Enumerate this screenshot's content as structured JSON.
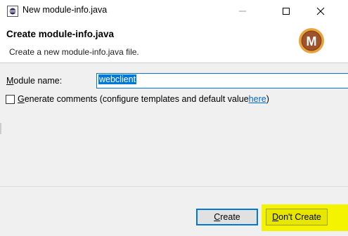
{
  "window": {
    "title": "New module-info.java",
    "controls": {
      "minimize": "—",
      "maximize": "☐",
      "close": "✕"
    },
    "icon": "eclipse-icon"
  },
  "header": {
    "title": "Create module-info.java",
    "description": "Create a new module-info.java file.",
    "logo": "maven-m-logo",
    "logo_letter": "M"
  },
  "form": {
    "module_name_label_prefix": "M",
    "module_name_label_rest": "odule name:",
    "module_name_value": "webclient",
    "generate_checkbox_checked": false,
    "generate_label_prefix": "G",
    "generate_label_rest": "enerate comments (configure templates and default value ",
    "generate_link": "here",
    "generate_label_suffix": ")"
  },
  "buttons": {
    "create_prefix": "C",
    "create_rest": "reate",
    "dont_create_prefix": "D",
    "dont_create_rest": "on't Create"
  },
  "colors": {
    "accent": "#0078d7",
    "highlight": "#f4f400",
    "logo_brown": "#8b4513",
    "logo_ring": "#e8a33d"
  }
}
